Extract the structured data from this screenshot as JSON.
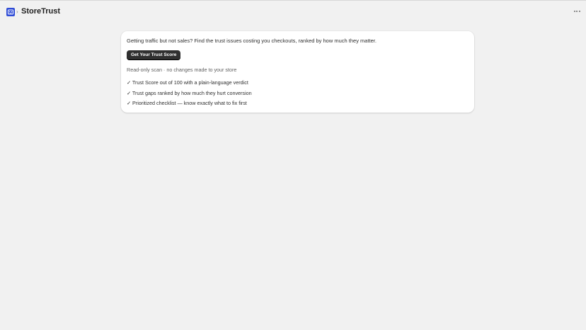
{
  "header": {
    "app_icon": "storetrust-app-icon",
    "separator": "›",
    "title": "StoreTrust",
    "menu_icon": "more-horizontal-icon"
  },
  "card": {
    "headline": "Getting traffic but not sales? Find the trust issues costing you checkouts, ranked by how much they matter.",
    "cta_label": "Get Your Trust Score",
    "note": "Read-only scan · no changes made to your store",
    "features": [
      "✓ Trust Score out of 100 with a plain-language verdict",
      "✓ Trust gaps ranked by how much they hurt conversion",
      "✓ Prioritized checklist — know exactly what to fix first"
    ]
  },
  "colors": {
    "background": "#f1f1f1",
    "card": "#ffffff",
    "button": "#303030",
    "app_icon": "#2f4cd6"
  }
}
